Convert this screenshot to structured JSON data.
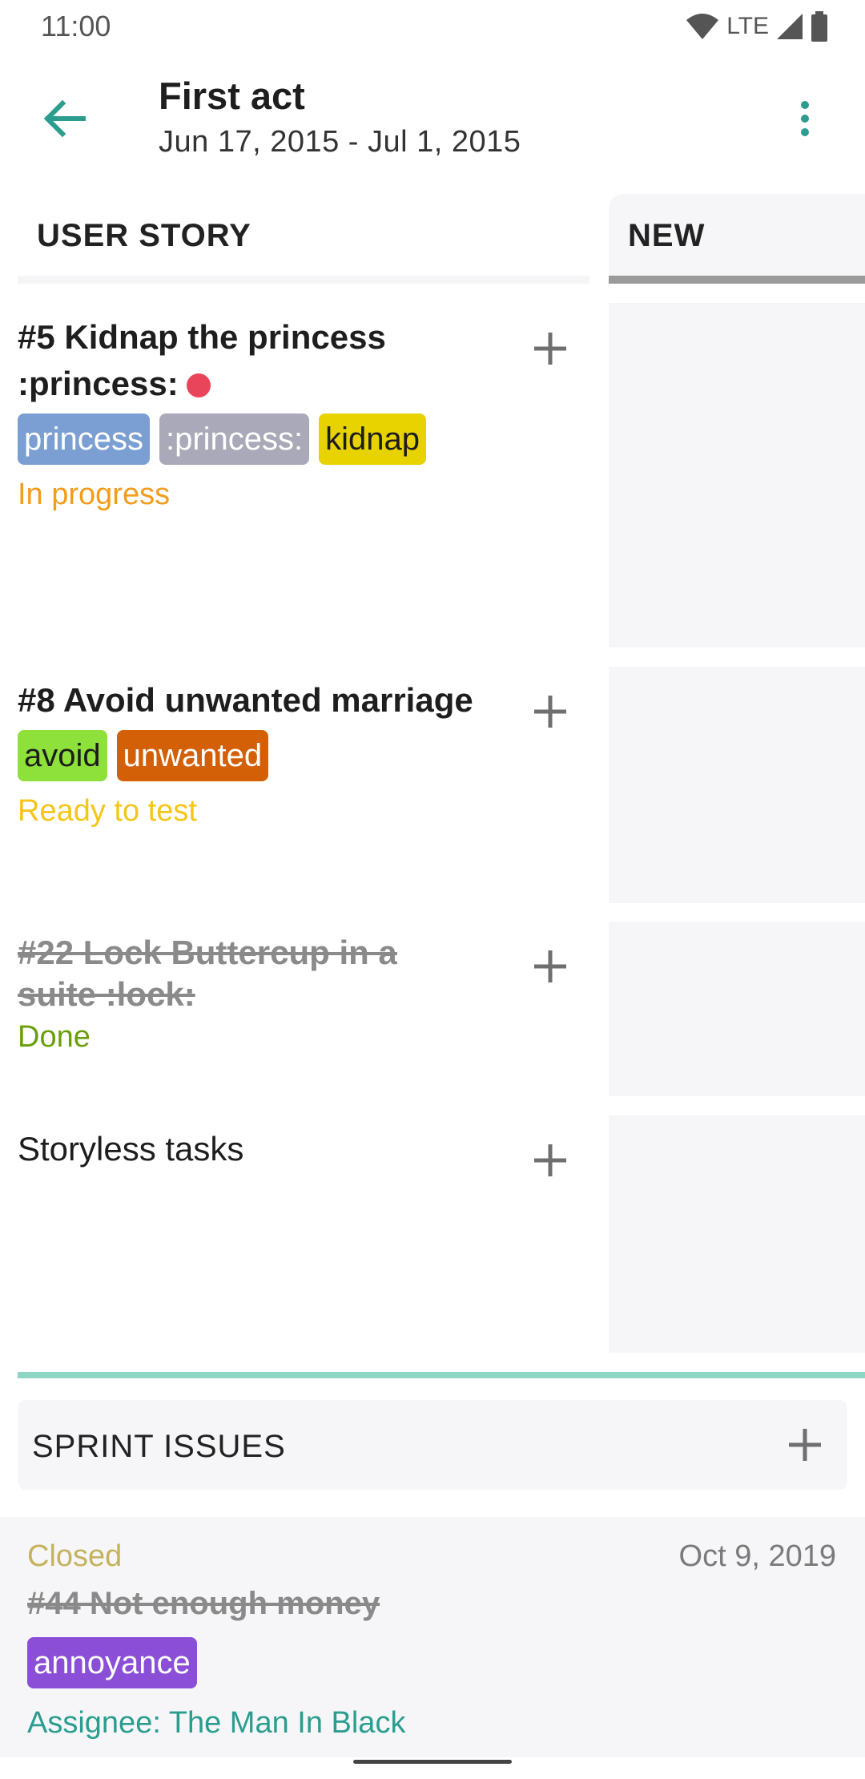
{
  "status_bar": {
    "time": "11:00",
    "network": "LTE"
  },
  "toolbar": {
    "title": "First act",
    "subtitle": "Jun 17, 2015 - Jul 1, 2015"
  },
  "columns": {
    "story": "USER STORY",
    "new": "NEW"
  },
  "stories": [
    {
      "title": "#5 Kidnap the princess :princess:",
      "status": "In progress",
      "status_color": "#f39c1c",
      "tags": [
        {
          "label": "princess",
          "bg": "#7b9fd3",
          "fg": "#ffffff"
        },
        {
          "label": ":princess:",
          "bg": "#a9a9b9",
          "fg": "#ffffff"
        },
        {
          "label": "kidnap",
          "bg": "#e8d200",
          "fg": "#1c1c1c"
        }
      ]
    },
    {
      "title": "#8 Avoid unwanted marriage",
      "status": "Ready to test",
      "status_color": "#f5c518",
      "tags": [
        {
          "label": "avoid",
          "bg": "#8ee03a",
          "fg": "#1c1c1c"
        },
        {
          "label": "unwanted",
          "bg": "#d36006",
          "fg": "#ffffff"
        }
      ]
    },
    {
      "title": "#22 Lock Buttercup in a suite :lock:",
      "status": "Done",
      "status_color": "#6a9f0b",
      "tags": []
    },
    {
      "title": "Storyless tasks"
    }
  ],
  "sprint": {
    "header": "SPRINT ISSUES",
    "issue": {
      "status": "Closed",
      "date": "Oct 9, 2019",
      "title": "#44 Not enough money",
      "tag": {
        "label": "annoyance",
        "bg": "#8a4fd6",
        "fg": "#ffffff"
      },
      "assignee": "Assignee: The Man In Black"
    }
  },
  "icons": {
    "back": "arrow-left-icon",
    "menu": "more-vert-icon",
    "add": "plus-icon",
    "accent_color": "#2a9d8f"
  }
}
